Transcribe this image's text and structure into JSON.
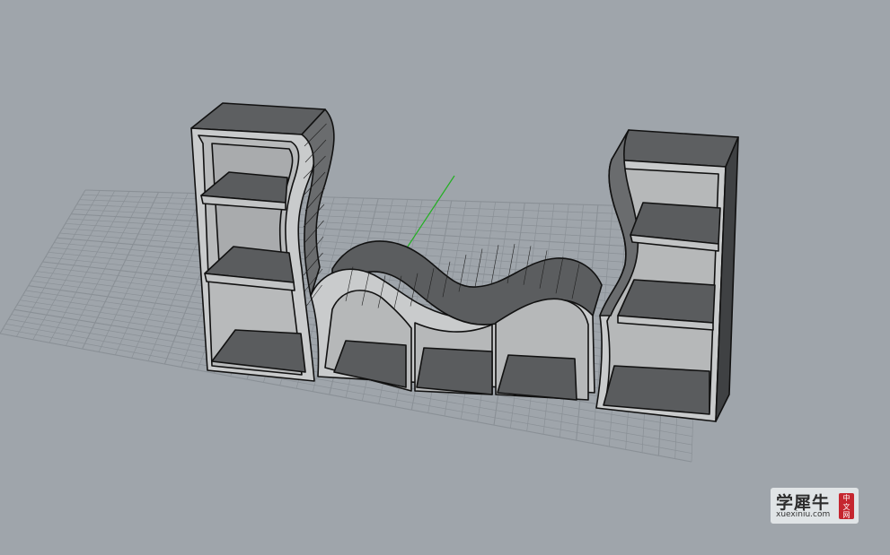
{
  "viewport": {
    "background_color": "#9fa5ab",
    "grid_color": "#8a9096",
    "y_axis_color": "#22b022",
    "model_dark_face": "#5a5c5e",
    "model_light_face": "#c9cbcc",
    "model_edge": "#111111"
  },
  "watermark": {
    "brand_cn": "学犀牛",
    "url": "xuexiniu.com",
    "badge": [
      "中",
      "文",
      "网"
    ]
  }
}
